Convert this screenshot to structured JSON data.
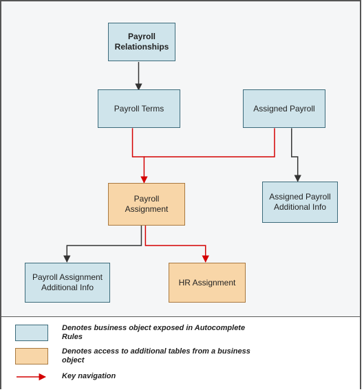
{
  "nodes": {
    "payrollRelationships": "Payroll Relationships",
    "payrollTerms": "Payroll Terms",
    "assignedPayroll": "Assigned Payroll",
    "payrollAssignment": "Payroll Assignment",
    "assignedPayrollAdditional": "Assigned Payroll Additional Info",
    "payrollAssignmentAdditional": "Payroll Assignment Additional Info",
    "hrAssignment": "HR Assignment"
  },
  "legend": {
    "blue": "Denotes business object exposed in Autocomplete Rules",
    "orange": "Denotes access to additional tables from a business object",
    "arrow": "Key navigation"
  }
}
